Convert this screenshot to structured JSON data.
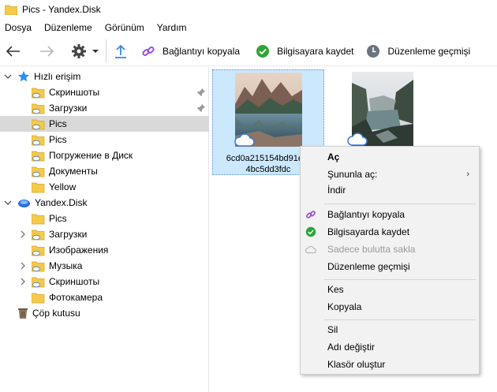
{
  "window": {
    "title": "Pics - Yandex.Disk"
  },
  "menu": [
    "Dosya",
    "Düzenleme",
    "Görünüm",
    "Yardım"
  ],
  "toolbar": {
    "copy_link": "Bağlantıyı kopyala",
    "save_to_pc": "Bilgisayara kaydet",
    "edit_history": "Düzenleme geçmişi"
  },
  "sidebar": {
    "quick_access": {
      "label": "Hızlı erişim",
      "items": [
        "Скриншоты",
        "Загрузки",
        "Pics",
        "Pics",
        "Погружение в Диск",
        "Документы",
        "Yellow"
      ]
    },
    "yandex_disk": {
      "label": "Yandex.Disk",
      "items": [
        "Pics",
        "Загрузки",
        "Изображения",
        "Музыка",
        "Скриншоты",
        "Фотокамера"
      ]
    },
    "trash": "Çöp kutusu"
  },
  "files": [
    {
      "name": "6cd0a215154bd91e0f...4bc5dd3fdc",
      "line1": "6cd0a215154bd91e0f",
      "line2": "4bc5dd3fdc"
    },
    {
      "name": ""
    }
  ],
  "context_menu": {
    "open": "Aç",
    "open_with": "Şununla aç:",
    "download": "İndir",
    "copy_link": "Bağlantıyı kopyala",
    "save_to_pc": "Bilgisayarda kaydet",
    "cloud_only": "Sadece bulutta sakla",
    "edit_history": "Düzenleme geçmişi",
    "cut": "Kes",
    "copy": "Kopyala",
    "delete": "Sil",
    "rename": "Adı değiştir",
    "new_folder": "Klasör oluştur"
  },
  "colors": {
    "accent": "#3b8ad9",
    "link_purple": "#9b4fcf",
    "save_green": "#2ea53a",
    "selection": "#cce8ff",
    "tree_selected": "#d9d9d9",
    "folder": "#f5c94a"
  }
}
